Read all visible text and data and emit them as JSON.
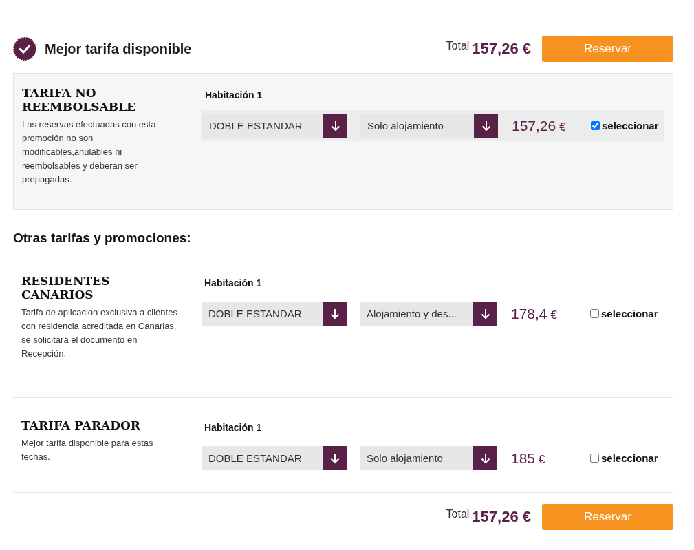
{
  "header": {
    "title": "Mejor tarifa disponible",
    "total_label": "Total",
    "total": "157,26 €",
    "button": "Reservar"
  },
  "featured": {
    "name": "TARIFA NO REEMBOLSABLE",
    "description": "Las reservas efectuadas con esta promoción no son modificables,anulables ni reembolsables y deberan ser prepagadas.",
    "room_label": "Habitación 1",
    "room_select": "DOBLE ESTANDAR",
    "plan_select": "Solo alojamiento",
    "price": "157,26",
    "currency": "€",
    "select_label": "seleccionar",
    "checked": true
  },
  "others_title": "Otras tarifas y promociones:",
  "others": [
    {
      "name": "RESIDENTES CANARIOS",
      "description": "Tarifa de aplicacion exclusiva a clientes con residencia acreditada en Canarias, se solicitará el documento en Recepción.",
      "room_label": "Habitación 1",
      "room_select": "DOBLE ESTANDAR",
      "plan_select": "Alojamiento y des...",
      "price": "178,4",
      "currency": "€",
      "select_label": "seleccionar",
      "checked": false
    },
    {
      "name": "TARIFA PARADOR",
      "description": "Mejor tarifa disponible para estas fechas.",
      "room_label": "Habitación 1",
      "room_select": "DOBLE ESTANDAR",
      "plan_select": "Solo alojamiento",
      "price": "185",
      "currency": "€",
      "select_label": "seleccionar",
      "checked": false
    }
  ],
  "footer": {
    "total_label": "Total",
    "total": "157,26 €",
    "button": "Reservar"
  }
}
